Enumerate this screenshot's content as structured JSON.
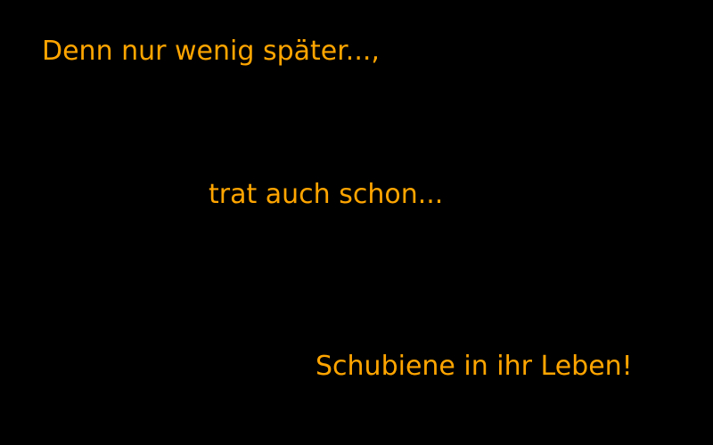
{
  "slide": {
    "text_color": "#FFA500",
    "background_color": "#000000",
    "lines": [
      "Denn nur wenig später...,",
      "trat auch schon...",
      "Schubiene in ihr Leben!"
    ]
  }
}
